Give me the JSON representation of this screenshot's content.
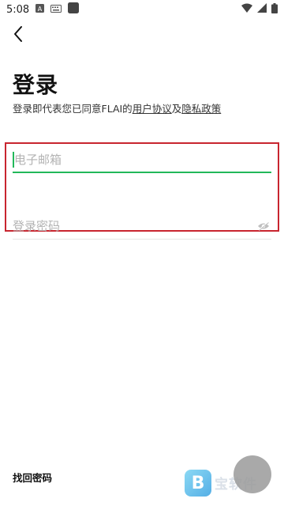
{
  "status_bar": {
    "time": "5:08",
    "icons": [
      "a-badge-icon",
      "keyboard-icon",
      "square-icon",
      "wifi-icon",
      "signal-icon",
      "battery-icon"
    ]
  },
  "page": {
    "title": "登录",
    "agreement_prefix": "登录即代表您已同意FLAI的",
    "user_agreement_link": "用户协议",
    "agreement_conjunction": "及",
    "privacy_link": "隐私政策"
  },
  "form": {
    "email_placeholder": "电子邮箱",
    "email_value": "",
    "password_placeholder": "登录密码",
    "password_value": "",
    "accent_color": "#22b85a",
    "highlight_color": "#c8252f"
  },
  "footer": {
    "forgot_password": "找回密码"
  },
  "watermark": {
    "logo_glyph": "B",
    "text": "宝软件"
  }
}
